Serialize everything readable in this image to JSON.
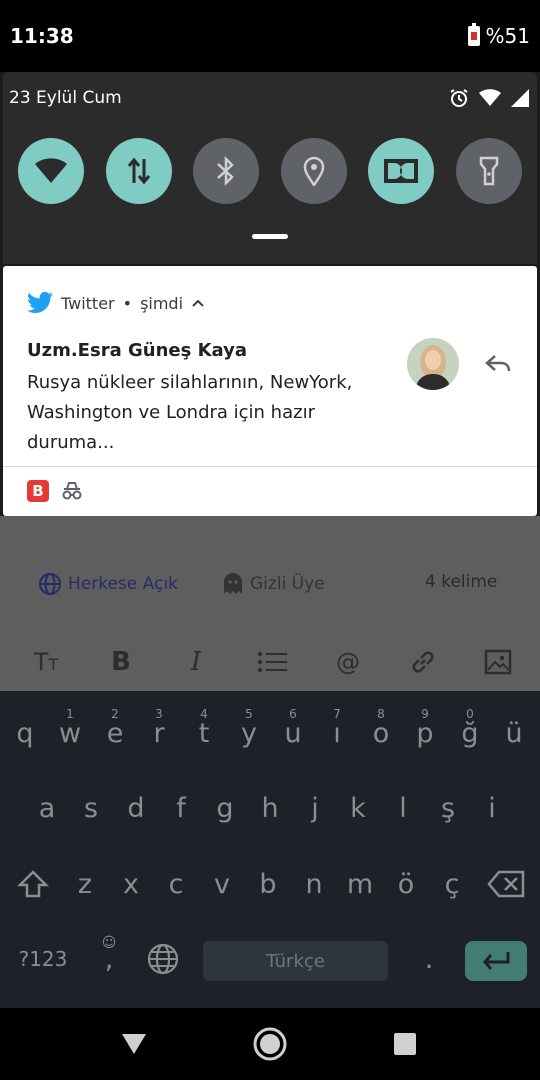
{
  "status_bar": {
    "time": "11:38",
    "battery": "%51"
  },
  "quick_settings": {
    "date": "23 Eylül Cum",
    "tiles": [
      {
        "name": "wifi",
        "icon": "wifi-icon",
        "active": true
      },
      {
        "name": "mobile-data",
        "icon": "data-transfer-icon",
        "active": true
      },
      {
        "name": "bluetooth",
        "icon": "bluetooth-icon",
        "active": false
      },
      {
        "name": "location",
        "icon": "location-pin-icon",
        "active": false
      },
      {
        "name": "dolby",
        "icon": "dolby-icon",
        "active": true
      },
      {
        "name": "flashlight",
        "icon": "flashlight-icon",
        "active": false
      }
    ]
  },
  "notification": {
    "app": "Twitter",
    "separator": "•",
    "time": "şimdi",
    "title": "Uzm.Esra Güneş Kaya",
    "text": "Rusya nükleer silahlarının, NewYork, Washington ve Londra için hazır duruma..."
  },
  "editor": {
    "visibility": "Herkese Açık",
    "member": "Gizli Üye",
    "word_count": "4 kelime"
  },
  "keyboard": {
    "row1": [
      "q",
      "w",
      "e",
      "r",
      "t",
      "y",
      "u",
      "ı",
      "o",
      "p",
      "ğ",
      "ü"
    ],
    "row1_hints": [
      "1",
      "2",
      "3",
      "4",
      "5",
      "6",
      "7",
      "8",
      "9",
      "0"
    ],
    "row2": [
      "a",
      "s",
      "d",
      "f",
      "g",
      "h",
      "j",
      "k",
      "l",
      "ş",
      "i"
    ],
    "row3": [
      "z",
      "x",
      "c",
      "v",
      "b",
      "n",
      "m",
      "ö",
      "ç"
    ],
    "symbols": "?123",
    "comma": ",",
    "space": "Türkçe",
    "period": "."
  },
  "colors": {
    "tile_on": "#80cbc4",
    "tile_off": "#5f6368",
    "twitter": "#1da1f2",
    "enter": "#447d76"
  }
}
